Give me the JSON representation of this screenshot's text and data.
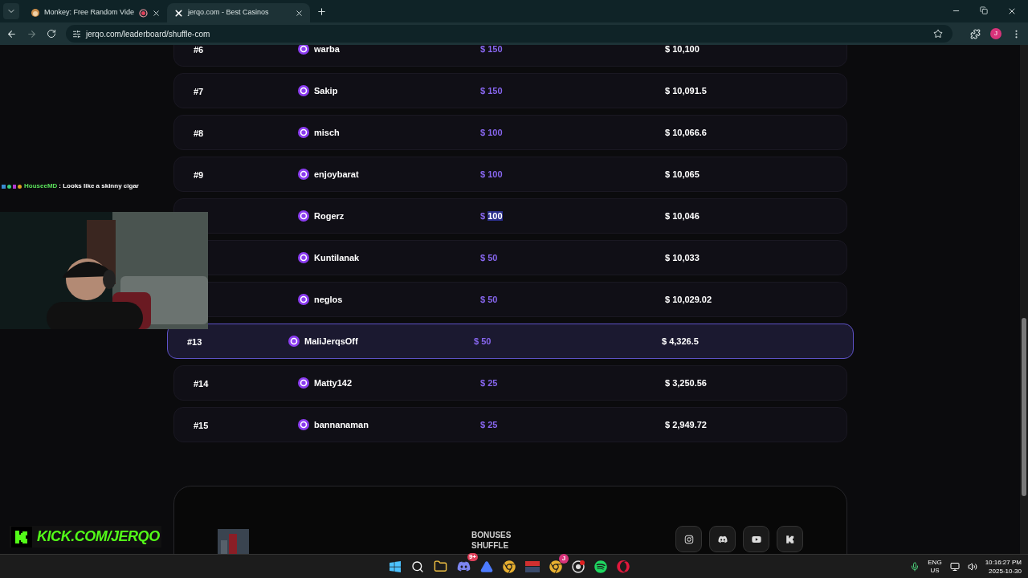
{
  "browser": {
    "tabs": [
      {
        "title": "Monkey: Free Random Vide",
        "selected": false,
        "recording": true
      },
      {
        "title": "jerqo.com - Best Casinos",
        "selected": true,
        "recording": false
      }
    ],
    "url": "jerqo.com/leaderboard/shuffle-com",
    "profile_initial": "J"
  },
  "leaderboard": {
    "rows": [
      {
        "rank": "#6",
        "name": "warba",
        "currency": "$",
        "prize": "150",
        "wagered": "$ 10,100",
        "selected": false,
        "prize_text_selected": false
      },
      {
        "rank": "#7",
        "name": "Sakip",
        "currency": "$",
        "prize": "150",
        "wagered": "$ 10,091.5",
        "selected": false,
        "prize_text_selected": false
      },
      {
        "rank": "#8",
        "name": "misch",
        "currency": "$",
        "prize": "100",
        "wagered": "$ 10,066.6",
        "selected": false,
        "prize_text_selected": false
      },
      {
        "rank": "#9",
        "name": "enjoybarat",
        "currency": "$",
        "prize": "100",
        "wagered": "$ 10,065",
        "selected": false,
        "prize_text_selected": false
      },
      {
        "name": "Rogerz",
        "currency": "$",
        "prize": "100",
        "wagered": "$ 10,046",
        "selected": false,
        "prize_text_selected": true
      },
      {
        "name": "Kuntilanak",
        "currency": "$",
        "prize": "50",
        "wagered": "$ 10,033",
        "selected": false,
        "prize_text_selected": false
      },
      {
        "name": "neglos",
        "currency": "$",
        "prize": "50",
        "wagered": "$ 10,029.02",
        "selected": false,
        "prize_text_selected": false
      },
      {
        "rank": "#13",
        "name": "MaliJerqsOff",
        "currency": "$",
        "prize": "50",
        "wagered": "$ 4,326.5",
        "selected": true,
        "prize_text_selected": false
      },
      {
        "rank": "#14",
        "name": "Matty142",
        "currency": "$",
        "prize": "25",
        "wagered": "$ 3,250.56",
        "selected": false,
        "prize_text_selected": false
      },
      {
        "rank": "#15",
        "name": "bannanaman",
        "currency": "$",
        "prize": "25",
        "wagered": "$ 2,949.72",
        "selected": false,
        "prize_text_selected": false
      }
    ]
  },
  "footer": {
    "links": [
      "BONUSES",
      "SHUFFLE"
    ]
  },
  "stream_overlay": {
    "chat": {
      "user": "HouseeMD",
      "message": ": Looks like a skinny cigar"
    },
    "channel": "KICK.COM/JERQO"
  },
  "taskbar": {
    "discord_badge": "9+",
    "chrome_badge": "J",
    "language": "ENG",
    "region": "US",
    "time": "10:16:27 PM",
    "date": "2025-10-30"
  }
}
